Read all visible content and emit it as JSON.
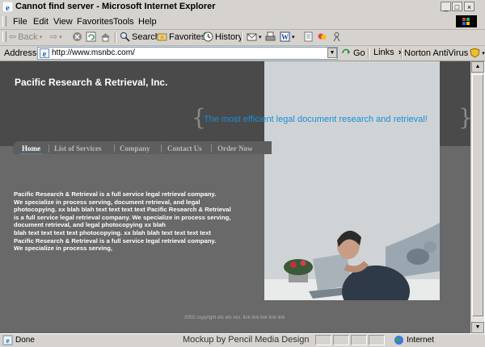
{
  "window": {
    "title": "Cannot find server - Microsoft Internet Explorer",
    "controls": {
      "minimize": "_",
      "restore": "□",
      "close": "×"
    }
  },
  "menu": [
    "File",
    "Edit",
    "View",
    "Favorites",
    "Tools",
    "Help"
  ],
  "toolbar": {
    "back": "Back",
    "search": "Search",
    "favorites": "Favorites",
    "history": "History"
  },
  "address": {
    "label": "Address",
    "url": "http://www.msnbc.com/",
    "go": "Go",
    "links": "Links",
    "links_more": "»",
    "antivirus": "Norton AntiVirus"
  },
  "site": {
    "title": "Pacific Research & Retrieval, Inc.",
    "tagline": "The most efficient legal document research and retrieval!",
    "brace_open": "{",
    "brace_close": "}",
    "nav": [
      "Home",
      "List of Services",
      "Company",
      "Contact Us",
      "Order Now"
    ],
    "active_nav": "Home",
    "body_lines": [
      "Pacific Research & Retrieval is a full service legal retrieval company.",
      "We specialize in process serving, document  retrieval, and legal",
      "photocopying. xx blah blah text text text text Pacific Research & Retrieval",
      "is a full service legal retrieval company. We specialize in process serving,",
      "document  retrieval, and legal photocopying xx blah",
      "blah text text text text photocopying. xx blah blah text text text text",
      "Pacific Research & Retrieval is a full service legal retrieval company.",
      "We specialize in process serving,"
    ],
    "footer": "2002 copyright etc etc xxx. link link link link link"
  },
  "status": {
    "text": "Done",
    "zone": "Internet"
  },
  "credit": "Mockup by Pencil Media Design",
  "colors": {
    "chrome": "#d6d3ce",
    "page_bg": "#696969",
    "header_bg": "#4a4a4a",
    "tagline": "#1a8ed8"
  }
}
